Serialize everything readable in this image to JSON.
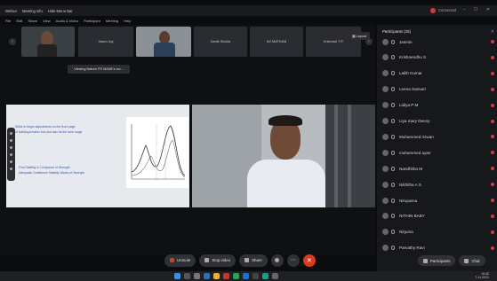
{
  "titlebar": {
    "items": [
      "Webex",
      "Meeting info",
      "Hide Menu Bar"
    ],
    "connection": "Connected"
  },
  "menu": [
    "File",
    "Edit",
    "Share",
    "View",
    "Audio & Video",
    "Participant",
    "Meeting",
    "Help"
  ],
  "strip": {
    "tiles": [
      "",
      "Jason Joy",
      "",
      "Kartik Shukla",
      "NV MATHAM",
      "Krishnan T R"
    ],
    "tooltip": "Viewing Nature PS MANE's scr...",
    "layout": "Layout"
  },
  "share_content": {
    "line1": "Strike to begin adjustments on the front page",
    "line2": "of building breaker box and also its the hard range",
    "line3": "Find Stability & Compound of Strength",
    "line4": "Adequate Confidence Stability Values of Strength"
  },
  "panel": {
    "title": "Participants (25)",
    "participants": [
      "Jasmin",
      "Krishnendhu S",
      "Lalith Kumar",
      "Leena Samuel",
      "Lidiya P M",
      "Liya mary Denny",
      "Muhammed rizwan",
      "muhammed ayan",
      "Nandhitha M",
      "Nikhitha A S",
      "Niruparna",
      "NITHIN BABY",
      "Nirjuma",
      "Parvathy Ravi"
    ]
  },
  "controls": {
    "unmute": "Unmute",
    "stop_video": "Stop video",
    "share": "Share",
    "participants": "Participants",
    "chat": "Chat"
  },
  "taskbar": {
    "time": "10:42",
    "date": "7-11-2021"
  },
  "colors": {
    "end_call": "#d9391c",
    "status_red": "#d23a3a"
  }
}
